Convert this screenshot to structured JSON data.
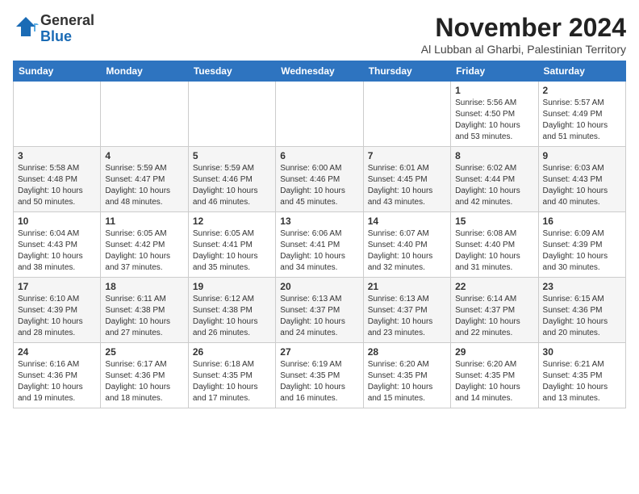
{
  "logo": {
    "general": "General",
    "blue": "Blue"
  },
  "header": {
    "month": "November 2024",
    "location": "Al Lubban al Gharbi, Palestinian Territory"
  },
  "weekdays": [
    "Sunday",
    "Monday",
    "Tuesday",
    "Wednesday",
    "Thursday",
    "Friday",
    "Saturday"
  ],
  "weeks": [
    [
      {
        "day": "",
        "info": ""
      },
      {
        "day": "",
        "info": ""
      },
      {
        "day": "",
        "info": ""
      },
      {
        "day": "",
        "info": ""
      },
      {
        "day": "",
        "info": ""
      },
      {
        "day": "1",
        "info": "Sunrise: 5:56 AM\nSunset: 4:50 PM\nDaylight: 10 hours and 53 minutes."
      },
      {
        "day": "2",
        "info": "Sunrise: 5:57 AM\nSunset: 4:49 PM\nDaylight: 10 hours and 51 minutes."
      }
    ],
    [
      {
        "day": "3",
        "info": "Sunrise: 5:58 AM\nSunset: 4:48 PM\nDaylight: 10 hours and 50 minutes."
      },
      {
        "day": "4",
        "info": "Sunrise: 5:59 AM\nSunset: 4:47 PM\nDaylight: 10 hours and 48 minutes."
      },
      {
        "day": "5",
        "info": "Sunrise: 5:59 AM\nSunset: 4:46 PM\nDaylight: 10 hours and 46 minutes."
      },
      {
        "day": "6",
        "info": "Sunrise: 6:00 AM\nSunset: 4:46 PM\nDaylight: 10 hours and 45 minutes."
      },
      {
        "day": "7",
        "info": "Sunrise: 6:01 AM\nSunset: 4:45 PM\nDaylight: 10 hours and 43 minutes."
      },
      {
        "day": "8",
        "info": "Sunrise: 6:02 AM\nSunset: 4:44 PM\nDaylight: 10 hours and 42 minutes."
      },
      {
        "day": "9",
        "info": "Sunrise: 6:03 AM\nSunset: 4:43 PM\nDaylight: 10 hours and 40 minutes."
      }
    ],
    [
      {
        "day": "10",
        "info": "Sunrise: 6:04 AM\nSunset: 4:43 PM\nDaylight: 10 hours and 38 minutes."
      },
      {
        "day": "11",
        "info": "Sunrise: 6:05 AM\nSunset: 4:42 PM\nDaylight: 10 hours and 37 minutes."
      },
      {
        "day": "12",
        "info": "Sunrise: 6:05 AM\nSunset: 4:41 PM\nDaylight: 10 hours and 35 minutes."
      },
      {
        "day": "13",
        "info": "Sunrise: 6:06 AM\nSunset: 4:41 PM\nDaylight: 10 hours and 34 minutes."
      },
      {
        "day": "14",
        "info": "Sunrise: 6:07 AM\nSunset: 4:40 PM\nDaylight: 10 hours and 32 minutes."
      },
      {
        "day": "15",
        "info": "Sunrise: 6:08 AM\nSunset: 4:40 PM\nDaylight: 10 hours and 31 minutes."
      },
      {
        "day": "16",
        "info": "Sunrise: 6:09 AM\nSunset: 4:39 PM\nDaylight: 10 hours and 30 minutes."
      }
    ],
    [
      {
        "day": "17",
        "info": "Sunrise: 6:10 AM\nSunset: 4:39 PM\nDaylight: 10 hours and 28 minutes."
      },
      {
        "day": "18",
        "info": "Sunrise: 6:11 AM\nSunset: 4:38 PM\nDaylight: 10 hours and 27 minutes."
      },
      {
        "day": "19",
        "info": "Sunrise: 6:12 AM\nSunset: 4:38 PM\nDaylight: 10 hours and 26 minutes."
      },
      {
        "day": "20",
        "info": "Sunrise: 6:13 AM\nSunset: 4:37 PM\nDaylight: 10 hours and 24 minutes."
      },
      {
        "day": "21",
        "info": "Sunrise: 6:13 AM\nSunset: 4:37 PM\nDaylight: 10 hours and 23 minutes."
      },
      {
        "day": "22",
        "info": "Sunrise: 6:14 AM\nSunset: 4:37 PM\nDaylight: 10 hours and 22 minutes."
      },
      {
        "day": "23",
        "info": "Sunrise: 6:15 AM\nSunset: 4:36 PM\nDaylight: 10 hours and 20 minutes."
      }
    ],
    [
      {
        "day": "24",
        "info": "Sunrise: 6:16 AM\nSunset: 4:36 PM\nDaylight: 10 hours and 19 minutes."
      },
      {
        "day": "25",
        "info": "Sunrise: 6:17 AM\nSunset: 4:36 PM\nDaylight: 10 hours and 18 minutes."
      },
      {
        "day": "26",
        "info": "Sunrise: 6:18 AM\nSunset: 4:35 PM\nDaylight: 10 hours and 17 minutes."
      },
      {
        "day": "27",
        "info": "Sunrise: 6:19 AM\nSunset: 4:35 PM\nDaylight: 10 hours and 16 minutes."
      },
      {
        "day": "28",
        "info": "Sunrise: 6:20 AM\nSunset: 4:35 PM\nDaylight: 10 hours and 15 minutes."
      },
      {
        "day": "29",
        "info": "Sunrise: 6:20 AM\nSunset: 4:35 PM\nDaylight: 10 hours and 14 minutes."
      },
      {
        "day": "30",
        "info": "Sunrise: 6:21 AM\nSunset: 4:35 PM\nDaylight: 10 hours and 13 minutes."
      }
    ]
  ]
}
